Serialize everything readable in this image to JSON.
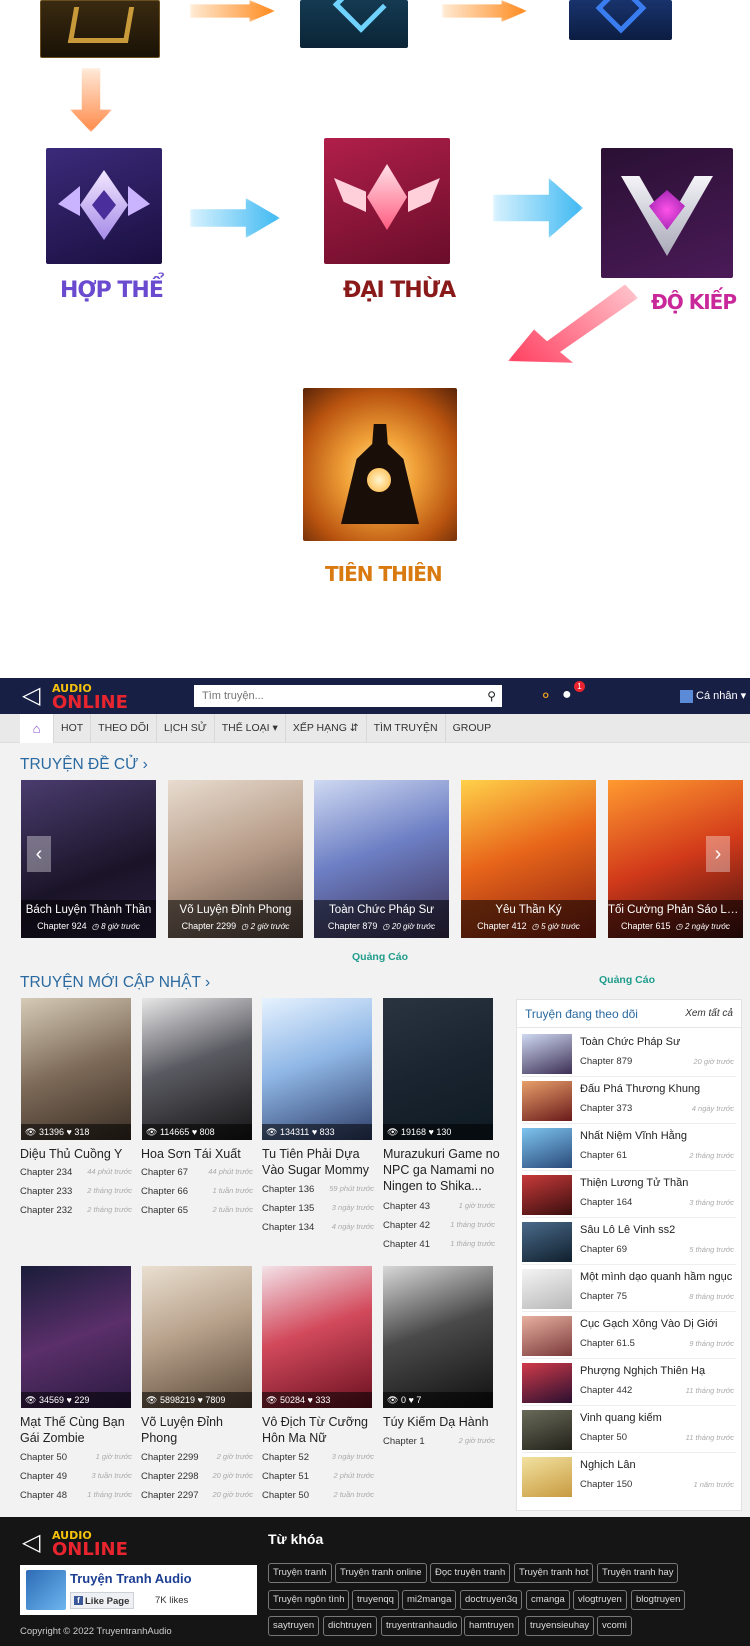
{
  "realm": {
    "labels": [
      "HỢP THỂ",
      "ĐẠI THỪA",
      "ĐỘ KIẾP",
      "TIÊN THIÊN"
    ]
  },
  "header": {
    "logo_top": "AUDIO",
    "logo_bottom": "ONLINE",
    "search_placeholder": "Tìm truyện...",
    "notif_count": "1",
    "user_label": "Cá nhân"
  },
  "menu": [
    "HOT",
    "THEO DÕI",
    "LỊCH SỬ",
    "THỂ LOẠI",
    "XẾP HẠNG",
    "TÌM TRUYỆN",
    "GROUP"
  ],
  "recommended": {
    "heading": "TRUYỆN ĐỀ CỬ",
    "items": [
      {
        "title": "Bách Luyện Thành Thần",
        "chapter": "Chapter 924",
        "time": "8 giờ trước"
      },
      {
        "title": "Võ Luyện Đỉnh Phong",
        "chapter": "Chapter 2299",
        "time": "2 giờ trước"
      },
      {
        "title": "Toàn Chức Pháp Sư",
        "chapter": "Chapter 879",
        "time": "20 giờ trước"
      },
      {
        "title": "Yêu Thần Ký",
        "chapter": "Chapter 412",
        "time": "5 giờ trước"
      },
      {
        "title": "Tối Cường Phản Sáo Lộ ...",
        "chapter": "Chapter 615",
        "time": "2 ngày trước"
      }
    ]
  },
  "ads": {
    "label": "Quảng Cáo"
  },
  "latest": {
    "heading": "TRUYỆN MỚI CẬP NHẬT",
    "items": [
      {
        "title": "Diệu Thủ Cuồng Y",
        "views": "31396",
        "likes": "318",
        "chapters": [
          [
            "Chapter 234",
            "44 phút trước"
          ],
          [
            "Chapter 233",
            "2 tháng trước"
          ],
          [
            "Chapter 232",
            "2 tháng trước"
          ]
        ]
      },
      {
        "title": "Hoa Sơn Tái Xuất",
        "views": "114665",
        "likes": "808",
        "chapters": [
          [
            "Chapter 67",
            "44 phút trước"
          ],
          [
            "Chapter 66",
            "1 tuần trước"
          ],
          [
            "Chapter 65",
            "2 tuần trước"
          ]
        ]
      },
      {
        "title": "Tu Tiên Phải Dựa Vào Sugar Mommy",
        "views": "134311",
        "likes": "833",
        "chapters": [
          [
            "Chapter 136",
            "59 phút trước"
          ],
          [
            "Chapter 135",
            "3 ngày trước"
          ],
          [
            "Chapter 134",
            "4 ngày trước"
          ]
        ]
      },
      {
        "title": "Murazukuri Game no NPC ga Namami no Ningen to Shika...",
        "views": "19168",
        "likes": "130",
        "chapters": [
          [
            "Chapter 43",
            "1 giờ trước"
          ],
          [
            "Chapter 42",
            "1 tháng trước"
          ],
          [
            "Chapter 41",
            "1 tháng trước"
          ]
        ]
      },
      {
        "title": "Mạt Thế Cùng Bạn Gái Zombie",
        "views": "34569",
        "likes": "229",
        "chapters": [
          [
            "Chapter 50",
            "1 giờ trước"
          ],
          [
            "Chapter 49",
            "3 tuần trước"
          ],
          [
            "Chapter 48",
            "1 tháng trước"
          ]
        ]
      },
      {
        "title": "Võ Luyện Đỉnh Phong",
        "views": "5898219",
        "likes": "7809",
        "chapters": [
          [
            "Chapter 2299",
            "2 giờ trước"
          ],
          [
            "Chapter 2298",
            "20 giờ trước"
          ],
          [
            "Chapter 2297",
            "20 giờ trước"
          ]
        ]
      },
      {
        "title": "Vô Địch Từ Cưỡng Hôn Ma Nữ",
        "views": "50284",
        "likes": "333",
        "chapters": [
          [
            "Chapter 52",
            "3 ngày trước"
          ],
          [
            "Chapter 51",
            "2 phút trước"
          ],
          [
            "Chapter 50",
            "2 tuần trước"
          ]
        ]
      },
      {
        "title": "Túy Kiếm Dạ Hành",
        "views": "0",
        "likes": "7",
        "chapters": [
          [
            "Chapter 1",
            "2 giờ trước"
          ]
        ]
      }
    ]
  },
  "sidebar": {
    "heading": "Truyện đang theo dõi",
    "see_all": "Xem tất cả",
    "items": [
      {
        "title": "Toàn Chức Pháp Sư",
        "chapter": "Chapter 879",
        "time": "20 giờ trước"
      },
      {
        "title": "Đấu Phá Thương Khung",
        "chapter": "Chapter 373",
        "time": "4 ngày trước"
      },
      {
        "title": "Nhất Niệm Vĩnh Hằng",
        "chapter": "Chapter 61",
        "time": "2 tháng trước"
      },
      {
        "title": "Thiện Lương Tử Thần",
        "chapter": "Chapter 164",
        "time": "3 tháng trước"
      },
      {
        "title": "Sâu Lô Lê Vinh ss2",
        "chapter": "Chapter 69",
        "time": "5 tháng trước"
      },
      {
        "title": "Một mình dạo quanh hầm ngục",
        "chapter": "Chapter 75",
        "time": "8 tháng trước"
      },
      {
        "title": "Cục Gạch Xông Vào Dị Giới",
        "chapter": "Chapter 61.5",
        "time": "9 tháng trước"
      },
      {
        "title": "Phượng Nghịch Thiên Hạ",
        "chapter": "Chapter 442",
        "time": "11 tháng trước"
      },
      {
        "title": "Vinh quang kiếm",
        "chapter": "Chapter 50",
        "time": "11 tháng trước"
      },
      {
        "title": "Nghịch Lân",
        "chapter": "Chapter 150",
        "time": "1 năm trước"
      }
    ]
  },
  "footer": {
    "keywords_heading": "Từ khóa",
    "tags": [
      "Truyện tranh",
      "Truyện tranh online",
      "Đọc truyện tranh",
      "Truyện tranh hot",
      "Truyện tranh hay",
      "Truyện ngôn tình",
      "truyenqq",
      "mi2manga",
      "doctruyen3q",
      "cmanga",
      "vlogtruyen",
      "blogtruyen",
      "saytruyen",
      "dichtruyen",
      "truyentranhaudio",
      "hamtruyen",
      "truyensieuhay",
      "vcomi"
    ],
    "fb_page": "Truyện Tranh Audio",
    "fb_like": "Like Page",
    "fb_count": "7K likes",
    "copyright": "Copyright © 2022 TruyentranhAudio"
  }
}
